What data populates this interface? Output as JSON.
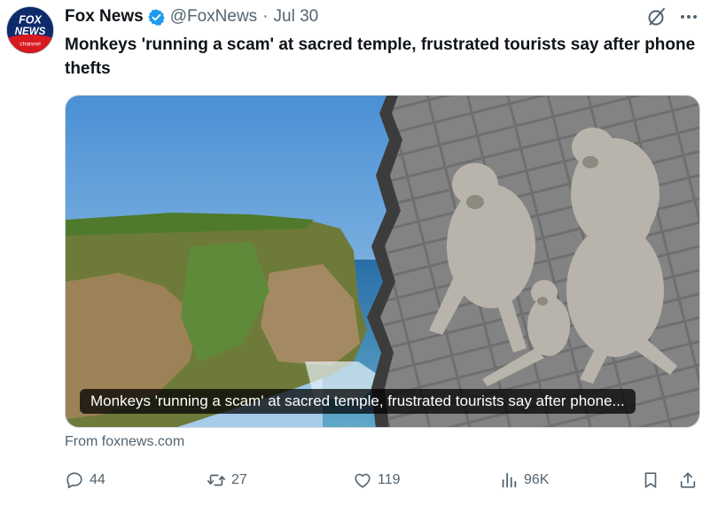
{
  "tweet": {
    "author_name": "Fox News",
    "handle": "@FoxNews",
    "separator": "·",
    "date": "Jul 30",
    "text": "Monkeys 'running a scam' at sacred temple, frustrated tourists say after phone thefts",
    "avatar_text_top": "FOX",
    "avatar_text_mid": "NEWS",
    "avatar_text_bottom": "channel"
  },
  "card": {
    "caption": "Monkeys 'running a scam' at sacred temple, frustrated tourists say after phone...",
    "source": "From foxnews.com"
  },
  "actions": {
    "replies": "44",
    "reposts": "27",
    "likes": "119",
    "views": "96K"
  },
  "icons": {
    "verified": "verified-badge-icon",
    "grok": "grok-icon",
    "more": "more-icon",
    "reply": "reply-icon",
    "repost": "repost-icon",
    "like": "heart-icon",
    "views": "views-icon",
    "bookmark": "bookmark-icon",
    "share": "share-icon"
  },
  "colors": {
    "text": "#0f1419",
    "muted": "#536471",
    "verified": "#1d9bf0",
    "avatar_bg": "#0d2a6b",
    "fox_red": "#d71920"
  }
}
